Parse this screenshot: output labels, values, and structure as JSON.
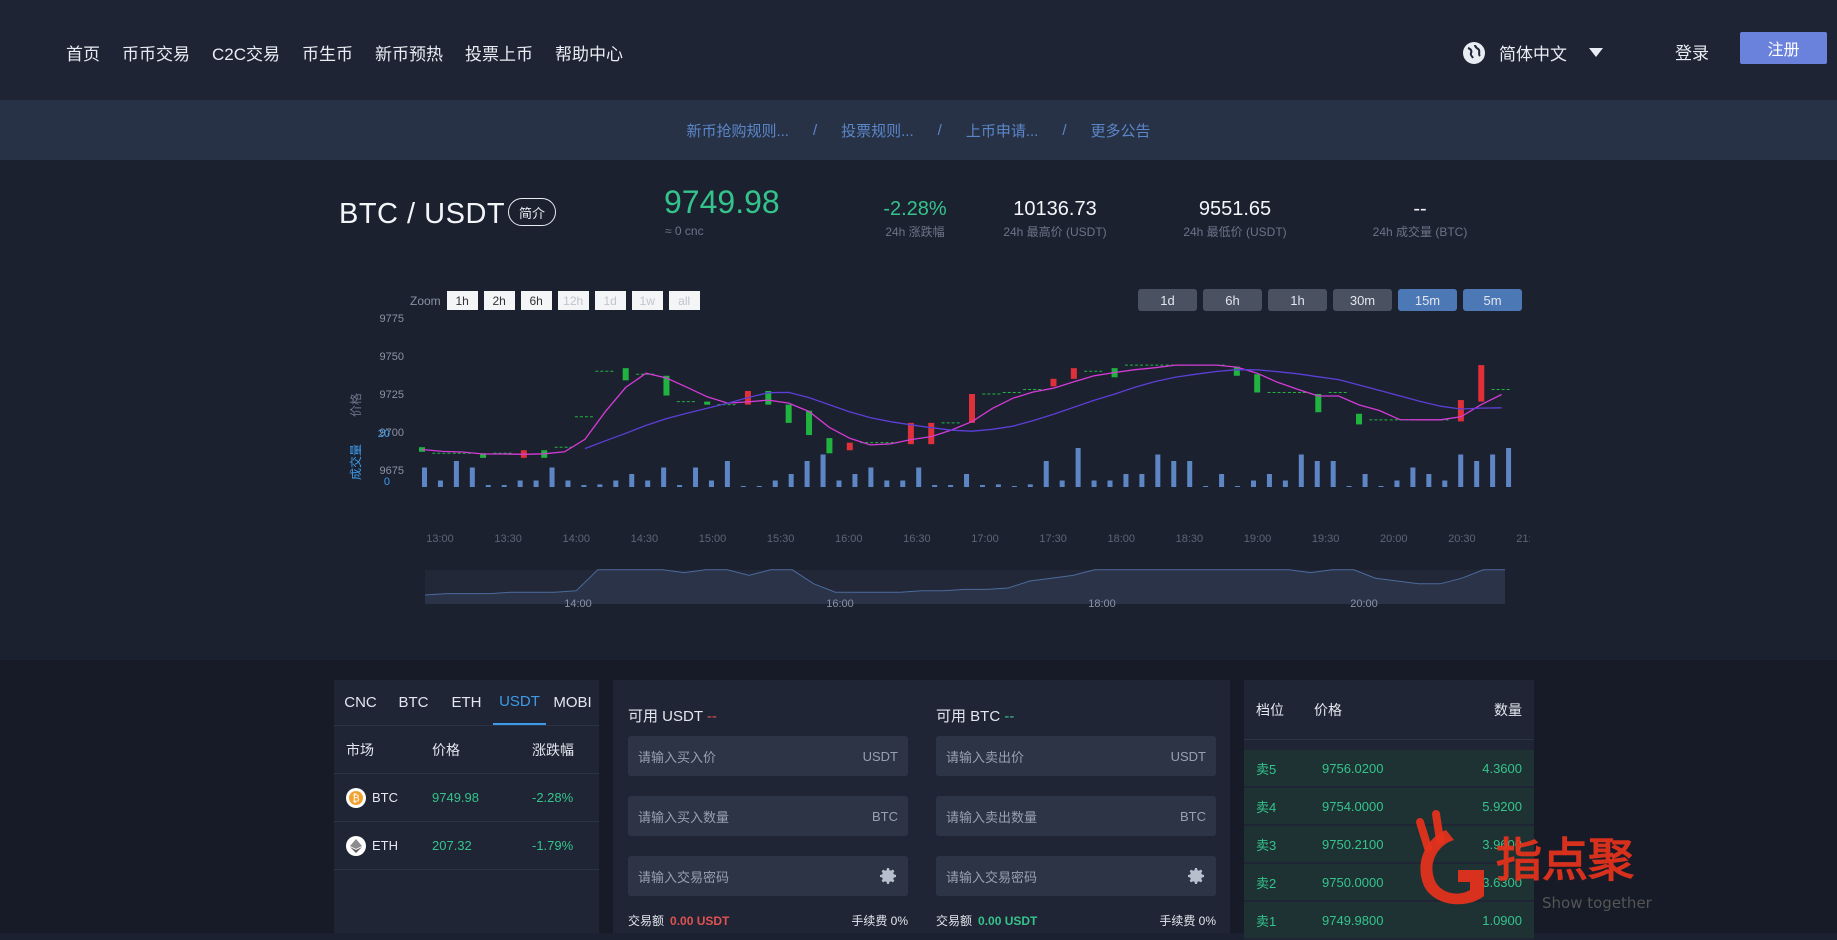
{
  "nav": {
    "items": [
      "首页",
      "币币交易",
      "C2C交易",
      "币生币",
      "新币预热",
      "投票上币",
      "帮助中心"
    ],
    "language": "简体中文",
    "login": "登录",
    "register": "注册"
  },
  "notices": [
    "新币抢购规则...",
    "投票规则...",
    "上币申请...",
    "更多公告"
  ],
  "notice_sep": "/",
  "ticker": {
    "pair": "BTC / USDT",
    "intro": "简介",
    "last_price": "9749.98",
    "last_price_cny": "≈ 0 cnc",
    "stats": [
      {
        "value": "-2.28%",
        "label": "24h 涨跌幅"
      },
      {
        "value": "10136.73",
        "label": "24h 最高价 (USDT)"
      },
      {
        "value": "9551.65",
        "label": "24h 最低价 (USDT)"
      },
      {
        "value": "--",
        "label": "24h 成交量 (BTC)"
      }
    ]
  },
  "chart_controls": {
    "zoom_label": "Zoom",
    "zoom": [
      "1h",
      "2h",
      "6h",
      "12h",
      "1d",
      "1w",
      "all"
    ],
    "periods": [
      "1d",
      "6h",
      "1h",
      "30m",
      "15m",
      "5m"
    ]
  },
  "chart_data": {
    "type": "candlestick",
    "ylabel": "价格",
    "ylim": [
      9675,
      9775
    ],
    "yticks": [
      9775,
      9750,
      9725,
      9700,
      9675
    ],
    "volume_label": "成交量",
    "volume_ticks": [
      20,
      0
    ],
    "xticks": [
      "13:00",
      "13:30",
      "14:00",
      "14:30",
      "15:00",
      "15:30",
      "16:00",
      "16:30",
      "17:00",
      "17:30",
      "18:00",
      "18:30",
      "19:00",
      "19:30",
      "20:00",
      "20:30",
      "21:00"
    ],
    "navigator_ticks": [
      "14:00",
      "16:00",
      "18:00",
      "20:00"
    ],
    "candles": [
      {
        "o": 9690,
        "c": 9687,
        "up": false
      },
      {
        "o": 9686,
        "c": 9686,
        "up": false
      },
      {
        "o": 9686,
        "c": 9686,
        "up": false
      },
      {
        "o": 9686,
        "c": 9683,
        "up": false
      },
      {
        "o": 9686,
        "c": 9686,
        "up": false
      },
      {
        "o": 9683,
        "c": 9688,
        "up": true
      },
      {
        "o": 9688,
        "c": 9683,
        "up": false
      },
      {
        "o": 9690,
        "c": 9690,
        "up": false
      },
      {
        "o": 9710,
        "c": 9710,
        "up": false
      },
      {
        "o": 9740,
        "c": 9740,
        "up": false
      },
      {
        "o": 9742,
        "c": 9734,
        "up": false
      },
      {
        "o": 9738,
        "c": 9738,
        "up": false
      },
      {
        "o": 9737,
        "c": 9724,
        "up": false
      },
      {
        "o": 9720,
        "c": 9720,
        "up": false
      },
      {
        "o": 9720,
        "c": 9718,
        "up": false
      },
      {
        "o": 9718,
        "c": 9718,
        "up": false
      },
      {
        "o": 9718,
        "c": 9727,
        "up": true
      },
      {
        "o": 9727,
        "c": 9718,
        "up": false
      },
      {
        "o": 9718,
        "c": 9706,
        "up": false
      },
      {
        "o": 9714,
        "c": 9698,
        "up": false
      },
      {
        "o": 9696,
        "c": 9686,
        "up": false
      },
      {
        "o": 9688,
        "c": 9693,
        "up": true
      },
      {
        "o": 9693,
        "c": 9693,
        "up": false
      },
      {
        "o": 9693,
        "c": 9693,
        "up": false
      },
      {
        "o": 9692,
        "c": 9706,
        "up": true
      },
      {
        "o": 9692,
        "c": 9706,
        "up": true
      },
      {
        "o": 9706,
        "c": 9706,
        "up": false
      },
      {
        "o": 9706,
        "c": 9725,
        "up": true
      },
      {
        "o": 9725,
        "c": 9725,
        "up": false
      },
      {
        "o": 9726,
        "c": 9726,
        "up": false
      },
      {
        "o": 9728,
        "c": 9728,
        "up": false
      },
      {
        "o": 9730,
        "c": 9735,
        "up": true
      },
      {
        "o": 9735,
        "c": 9742,
        "up": true
      },
      {
        "o": 9740,
        "c": 9740,
        "up": false
      },
      {
        "o": 9742,
        "c": 9736,
        "up": false
      },
      {
        "o": 9744,
        "c": 9744,
        "up": false
      },
      {
        "o": 9744,
        "c": 9744,
        "up": false
      },
      {
        "o": 9744,
        "c": 9744,
        "up": false
      },
      {
        "o": 9744,
        "c": 9744,
        "up": false
      },
      {
        "o": 9744,
        "c": 9744,
        "up": false
      },
      {
        "o": 9743,
        "c": 9737,
        "up": false
      },
      {
        "o": 9738,
        "c": 9726,
        "up": false
      },
      {
        "o": 9726,
        "c": 9726,
        "up": false
      },
      {
        "o": 9726,
        "c": 9726,
        "up": false
      },
      {
        "o": 9725,
        "c": 9713,
        "up": false
      },
      {
        "o": 9726,
        "c": 9726,
        "up": false
      },
      {
        "o": 9712,
        "c": 9705,
        "up": false
      },
      {
        "o": 9708,
        "c": 9708,
        "up": false
      },
      {
        "o": 9708,
        "c": 9708,
        "up": false
      },
      {
        "o": 9708,
        "c": 9708,
        "up": false
      },
      {
        "o": 9708,
        "c": 9708,
        "up": false
      },
      {
        "o": 9707,
        "c": 9721,
        "up": true
      },
      {
        "o": 9720,
        "c": 9744,
        "up": true
      },
      {
        "o": 9728,
        "c": 9728,
        "up": false
      }
    ]
  },
  "market": {
    "tabs": [
      "CNC",
      "BTC",
      "ETH",
      "USDT",
      "MOBI"
    ],
    "active_tab": "USDT",
    "headers": [
      "市场",
      "价格",
      "涨跌幅"
    ],
    "rows": [
      {
        "coin": "BTC",
        "icon": "bitcoin-icon",
        "price": "9749.98",
        "change": "-2.28%"
      },
      {
        "coin": "ETH",
        "icon": "ethereum-icon",
        "price": "207.32",
        "change": "-1.79%"
      }
    ]
  },
  "trade": {
    "buy": {
      "title": "可用 USDT",
      "available": "--",
      "price_ph": "请输入买入价",
      "price_unit": "USDT",
      "qty_ph": "请输入买入数量",
      "qty_unit": "BTC",
      "pwd_ph": "请输入交易密码",
      "amount_label": "交易额",
      "amount": "0.00 USDT",
      "fee": "手续费 0%"
    },
    "sell": {
      "title": "可用 BTC",
      "available": "--",
      "price_ph": "请输入卖出价",
      "price_unit": "USDT",
      "qty_ph": "请输入卖出数量",
      "qty_unit": "BTC",
      "pwd_ph": "请输入交易密码",
      "amount_label": "交易额",
      "amount": "0.00 USDT",
      "fee": "手续费 0%"
    }
  },
  "orderbook": {
    "headers": [
      "档位",
      "价格",
      "数量"
    ],
    "asks": [
      {
        "level": "卖5",
        "price": "9756.0200",
        "qty": "4.3600"
      },
      {
        "level": "卖4",
        "price": "9754.0000",
        "qty": "5.9200"
      },
      {
        "level": "卖3",
        "price": "9750.2100",
        "qty": "3.9600"
      },
      {
        "level": "卖2",
        "price": "9750.0000",
        "qty": "3.6300"
      },
      {
        "level": "卖1",
        "price": "9749.9800",
        "qty": "1.0900"
      }
    ]
  },
  "watermark": {
    "text": "指点聚",
    "sub": "Show together"
  },
  "colors": {
    "up": "#e0303a",
    "down": "#21b33f",
    "accent": "#3d9be9",
    "brand": "#6b82dd"
  }
}
